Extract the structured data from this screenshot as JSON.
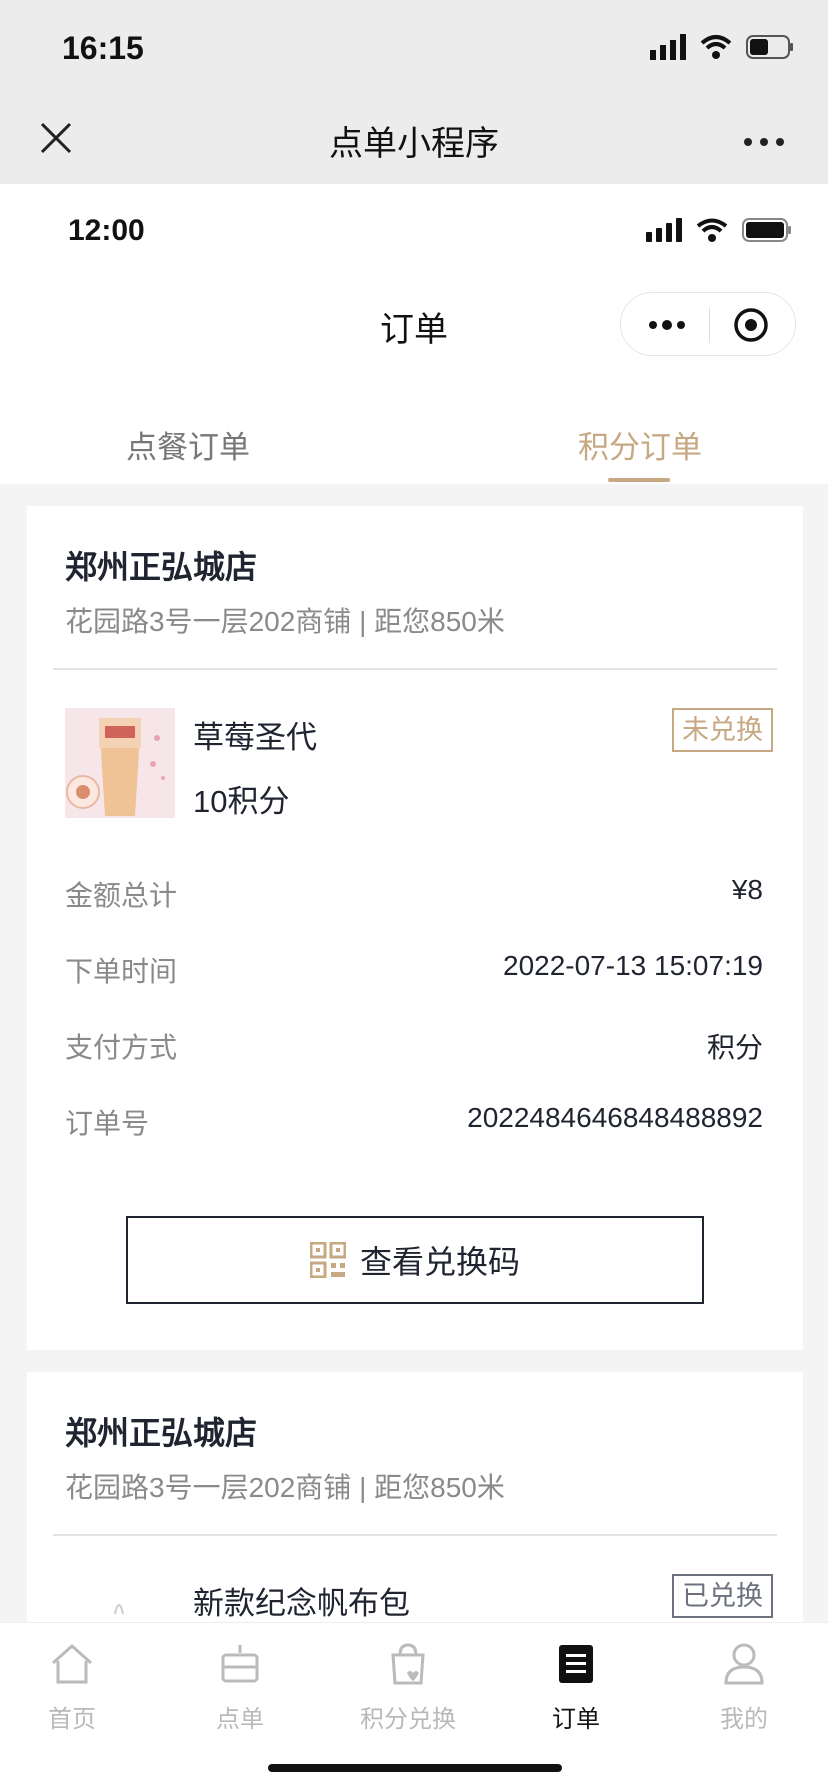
{
  "system": {
    "time": "16:15"
  },
  "outer_header": {
    "title": "点单小程序"
  },
  "inner_status": {
    "time": "12:00"
  },
  "inner_nav": {
    "title": "订单"
  },
  "tabs": [
    {
      "label": "点餐订单",
      "active": false
    },
    {
      "label": "积分订单",
      "active": true
    }
  ],
  "orders": [
    {
      "store_name": "郑州正弘城店",
      "store_address": "花园路3号一层202商铺 | 距您850米",
      "item_name": "草莓圣代",
      "item_points": "10积分",
      "status": "未兑换",
      "rows": [
        {
          "label": "金额总计",
          "value": "¥8"
        },
        {
          "label": "下单时间",
          "value": "2022-07-13 15:07:19"
        },
        {
          "label": "支付方式",
          "value": "积分"
        },
        {
          "label": "订单号",
          "value": "2022484646848488892"
        }
      ],
      "action_label": "查看兑换码"
    },
    {
      "store_name": "郑州正弘城店",
      "store_address": "花园路3号一层202商铺 | 距您850米",
      "item_name": "新款纪念帆布包",
      "status": "已兑换"
    }
  ],
  "tabbar": [
    {
      "label": "首页",
      "icon": "home-icon",
      "active": false
    },
    {
      "label": "点单",
      "icon": "cake-icon",
      "active": false
    },
    {
      "label": "积分兑换",
      "icon": "gift-bag-icon",
      "active": false
    },
    {
      "label": "订单",
      "icon": "order-list-icon",
      "active": true
    },
    {
      "label": "我的",
      "icon": "user-icon",
      "active": false
    }
  ],
  "colors": {
    "accent": "#c6a882",
    "text": "#1f2430",
    "muted": "#8a8a8a"
  }
}
